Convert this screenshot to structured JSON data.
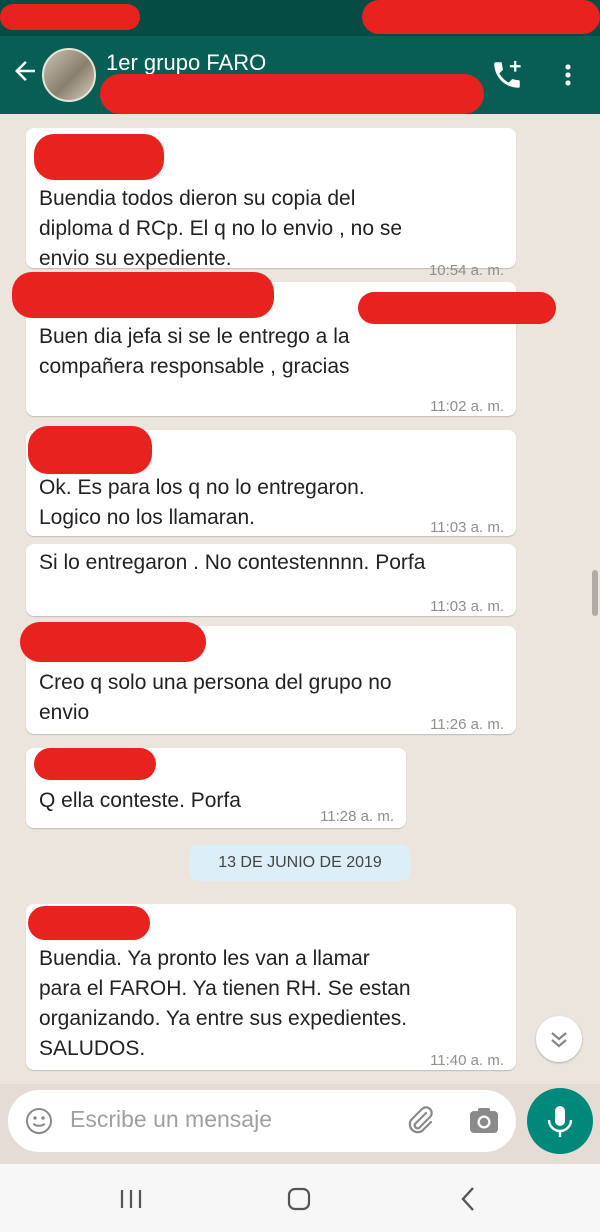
{
  "header": {
    "title": "1er grupo FARO"
  },
  "messages": [
    {
      "text": "Buendia todos dieron su copia del\ndiploma d RCp. El q no lo envio , no se\nenvio su expediente.",
      "time": "10:54 a. m."
    },
    {
      "text": "Buen dia jefa si se le entrego a la\ncompañera responsable , gracias",
      "time": "11:02 a. m."
    },
    {
      "text": "Ok. Es para los q no lo entregaron.\nLogico no los llamaran.",
      "time": "11:03 a. m."
    },
    {
      "text": "Si lo entregaron . No contestennnn. Porfa",
      "time": "11:03 a. m."
    },
    {
      "text": "Creo q solo una persona del grupo no\nenvio",
      "time": "11:26 a. m."
    },
    {
      "text": "Q ella conteste. Porfa",
      "time": "11:28 a. m."
    },
    {
      "text": "Buendia. Ya pronto les van a llamar\npara el FAROH. Ya tienen RH. Se estan\norganizando. Ya entre sus expedientes.\nSALUDOS.",
      "time": "11:40 a. m."
    }
  ],
  "date_separator": "13 DE JUNIO DE 2019",
  "composer": {
    "placeholder": "Escribe un mensaje"
  },
  "colors": {
    "header": "#075e54",
    "status_bar": "#054d44",
    "chat_background": "#ece5dd",
    "mic_button": "#00897b",
    "redaction": "#e8221f"
  }
}
